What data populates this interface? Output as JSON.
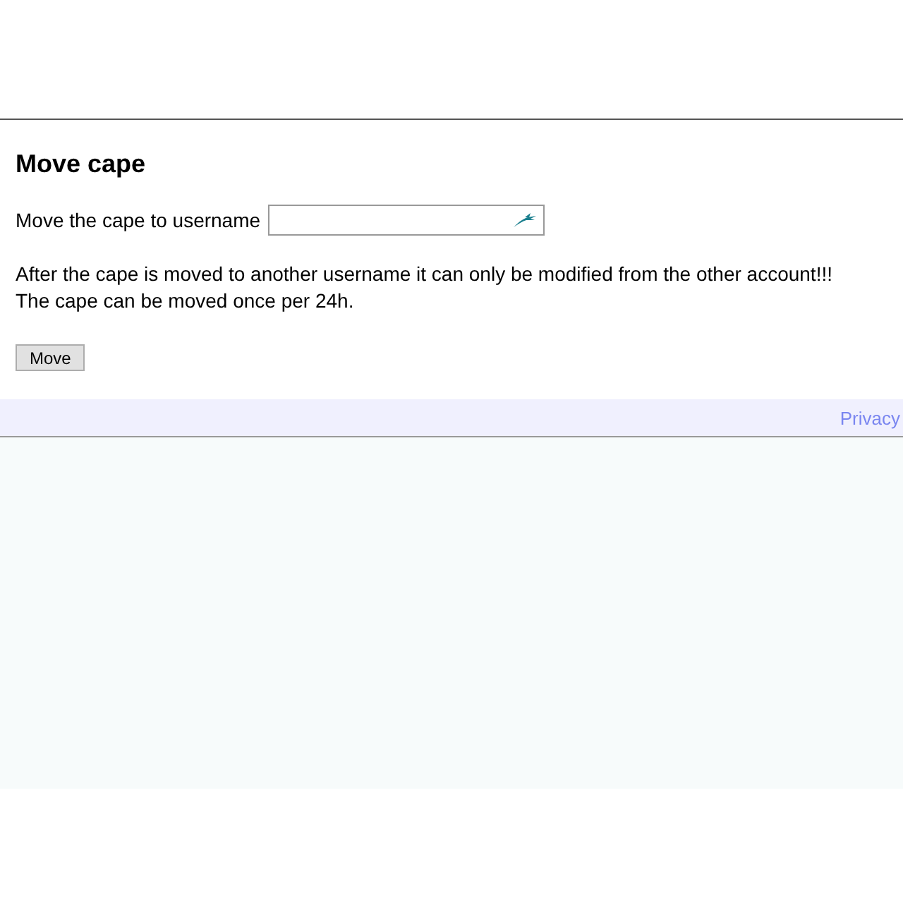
{
  "heading": "Move cape",
  "form": {
    "label": "Move the cape to username"
  },
  "notice_lines": [
    "After the cape is moved to another username it can only be modified from the other account!!!",
    "The cape can be moved once per 24h."
  ],
  "buttons": [
    "Move"
  ],
  "footer": {
    "link": "Privacy"
  }
}
